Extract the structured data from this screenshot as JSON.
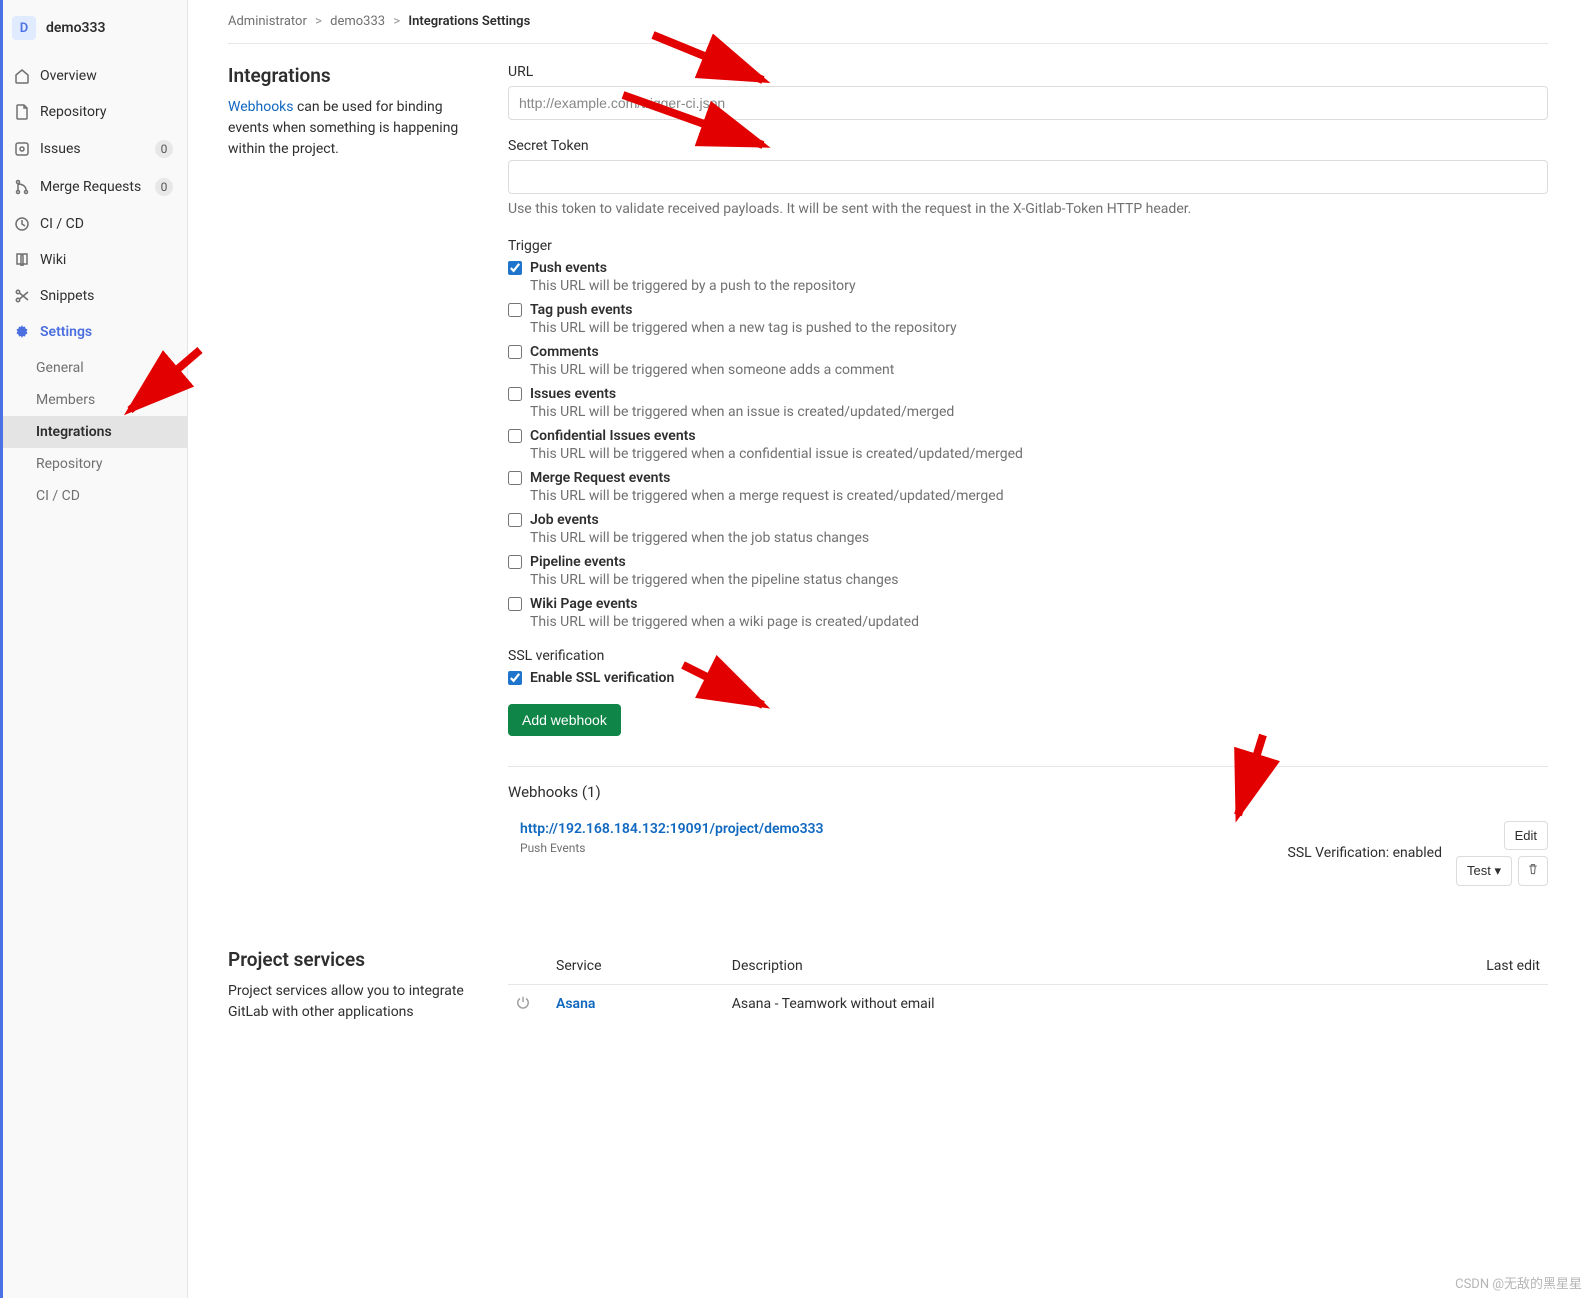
{
  "project": {
    "avatar_letter": "D",
    "name": "demo333"
  },
  "nav": {
    "overview": "Overview",
    "repository": "Repository",
    "issues": "Issues",
    "issues_count": "0",
    "merge_requests": "Merge Requests",
    "mr_count": "0",
    "cicd": "CI / CD",
    "wiki": "Wiki",
    "snippets": "Snippets",
    "settings": "Settings"
  },
  "subnav": {
    "general": "General",
    "members": "Members",
    "integrations": "Integrations",
    "repository": "Repository",
    "cicd": "CI / CD"
  },
  "breadcrumb": {
    "admin": "Administrator",
    "project": "demo333",
    "current": "Integrations Settings",
    "sep": ">"
  },
  "integrations": {
    "heading": "Integrations",
    "desc_prefix": "Webhooks",
    "desc_rest": " can be used for binding events when something is happening within the project."
  },
  "form": {
    "url_label": "URL",
    "url_placeholder": "http://example.com/trigger-ci.json",
    "secret_label": "Secret Token",
    "secret_help": "Use this token to validate received payloads. It will be sent with the request in the X-Gitlab-Token HTTP header.",
    "trigger_label": "Trigger",
    "triggers": [
      {
        "label": "Push events",
        "desc": "This URL will be triggered by a push to the repository",
        "checked": true
      },
      {
        "label": "Tag push events",
        "desc": "This URL will be triggered when a new tag is pushed to the repository",
        "checked": false
      },
      {
        "label": "Comments",
        "desc": "This URL will be triggered when someone adds a comment",
        "checked": false
      },
      {
        "label": "Issues events",
        "desc": "This URL will be triggered when an issue is created/updated/merged",
        "checked": false
      },
      {
        "label": "Confidential Issues events",
        "desc": "This URL will be triggered when a confidential issue is created/updated/merged",
        "checked": false
      },
      {
        "label": "Merge Request events",
        "desc": "This URL will be triggered when a merge request is created/updated/merged",
        "checked": false
      },
      {
        "label": "Job events",
        "desc": "This URL will be triggered when the job status changes",
        "checked": false
      },
      {
        "label": "Pipeline events",
        "desc": "This URL will be triggered when the pipeline status changes",
        "checked": false
      },
      {
        "label": "Wiki Page events",
        "desc": "This URL will be triggered when a wiki page is created/updated",
        "checked": false
      }
    ],
    "ssl_heading": "SSL verification",
    "ssl_label": "Enable SSL verification",
    "ssl_checked": true,
    "submit": "Add webhook"
  },
  "hooks": {
    "title": "Webhooks (1)",
    "entries": [
      {
        "url": "http://192.168.184.132:19091/project/demo333",
        "tags": "Push Events",
        "ssl": "SSL Verification: enabled"
      }
    ],
    "edit": "Edit",
    "test": "Test"
  },
  "services": {
    "heading": "Project services",
    "desc": "Project services allow you to integrate GitLab with other applications",
    "cols": {
      "service": "Service",
      "description": "Description",
      "last_edit": "Last edit"
    },
    "rows": [
      {
        "name": "Asana",
        "desc": "Asana - Teamwork without email",
        "last_edit": ""
      }
    ]
  },
  "watermark": "CSDN @无敌的黑星星"
}
